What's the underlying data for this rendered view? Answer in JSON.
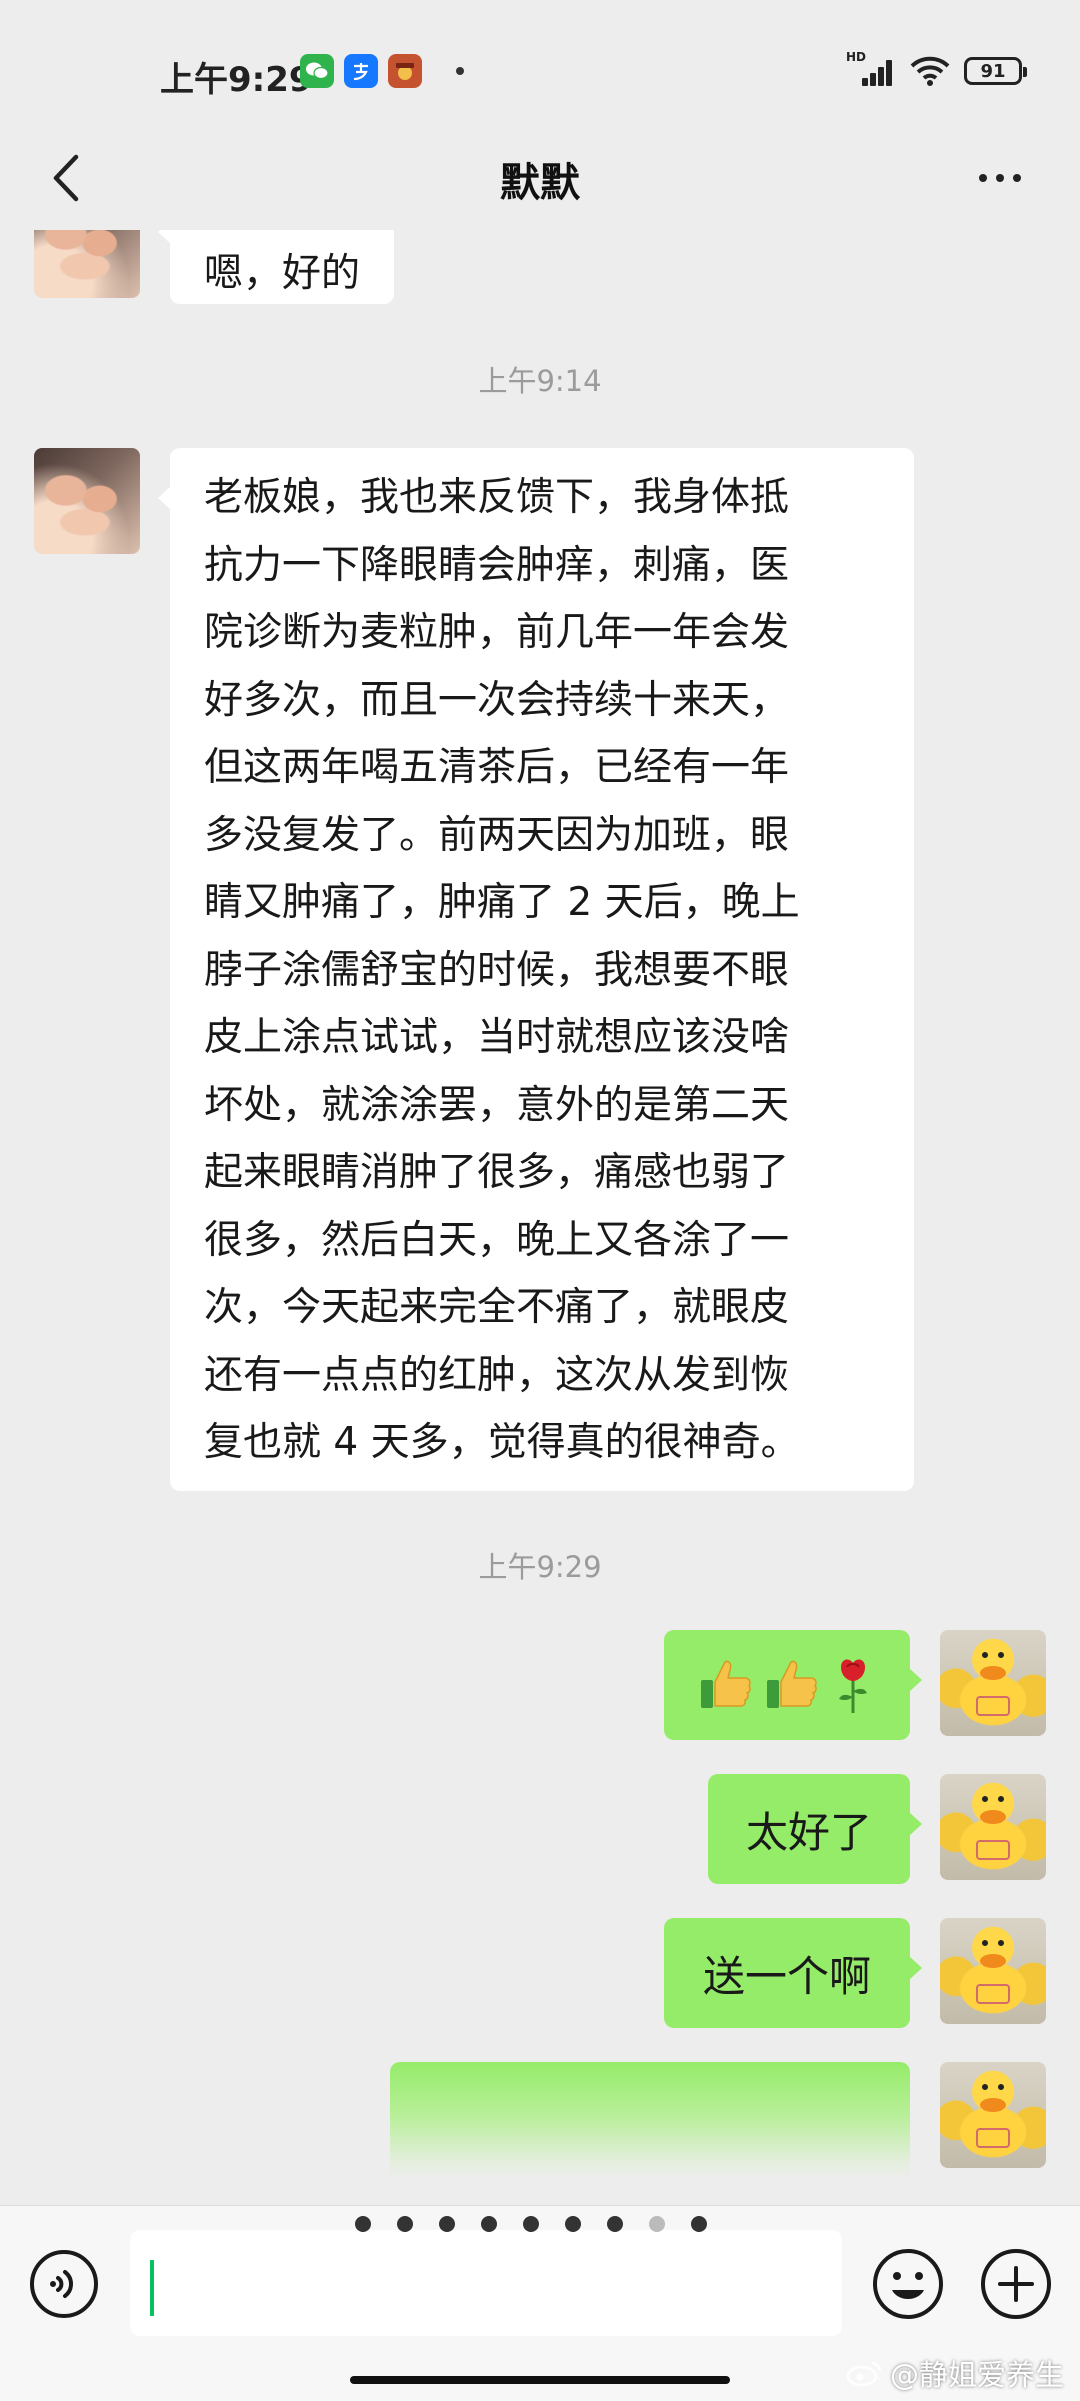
{
  "status_bar": {
    "time": "上午9:29",
    "notification_icons": [
      "wechat-icon",
      "alipay-icon",
      "game-app-icon"
    ],
    "network": "HD",
    "battery": "91"
  },
  "header": {
    "title": "默默"
  },
  "messages": [
    {
      "type": "text",
      "sender": "contact",
      "text": "嗯，好的"
    },
    {
      "type": "timestamp",
      "text": "上午9:14"
    },
    {
      "type": "text",
      "sender": "contact",
      "lines": [
        "老板娘，我也来反馈下，我身体抵",
        "抗力一下降眼睛会肿痒，刺痛，医",
        "院诊断为麦粒肿，前几年一年会发",
        "好多次，而且一次会持续十来天，",
        "但这两年喝五清茶后，已经有一年",
        "多没复发了。前两天因为加班，眼",
        "睛又肿痛了，肿痛了 2 天后，晚上",
        "脖子涂儒舒宝的时候，我想要不眼",
        "皮上涂点试试，当时就想应该没啥",
        "坏处，就涂涂罢，意外的是第二天",
        "起来眼睛消肿了很多，痛感也弱了",
        "很多，然后白天，晚上又各涂了一",
        "次，今天起来完全不痛了，就眼皮",
        "还有一点点的红肿，这次从发到恢",
        "复也就 4 天多，觉得真的很神奇。"
      ]
    },
    {
      "type": "timestamp",
      "text": "上午9:29"
    },
    {
      "type": "emoji",
      "sender": "self",
      "items": [
        "thumbs-up-icon",
        "thumbs-up-icon",
        "rose-icon"
      ]
    },
    {
      "type": "text",
      "sender": "self",
      "text": "太好了"
    },
    {
      "type": "text",
      "sender": "self",
      "text": "送一个啊"
    },
    {
      "type": "image",
      "sender": "self"
    }
  ],
  "input_bar": {
    "page_dots": 9,
    "active_dot": 8
  },
  "watermark": "@静姐爱养生",
  "colors": {
    "background": "#ededed",
    "self_bubble": "#95ec69",
    "contact_bubble": "#ffffff",
    "timestamp": "#9b9b9b",
    "cursor": "#07c160"
  }
}
